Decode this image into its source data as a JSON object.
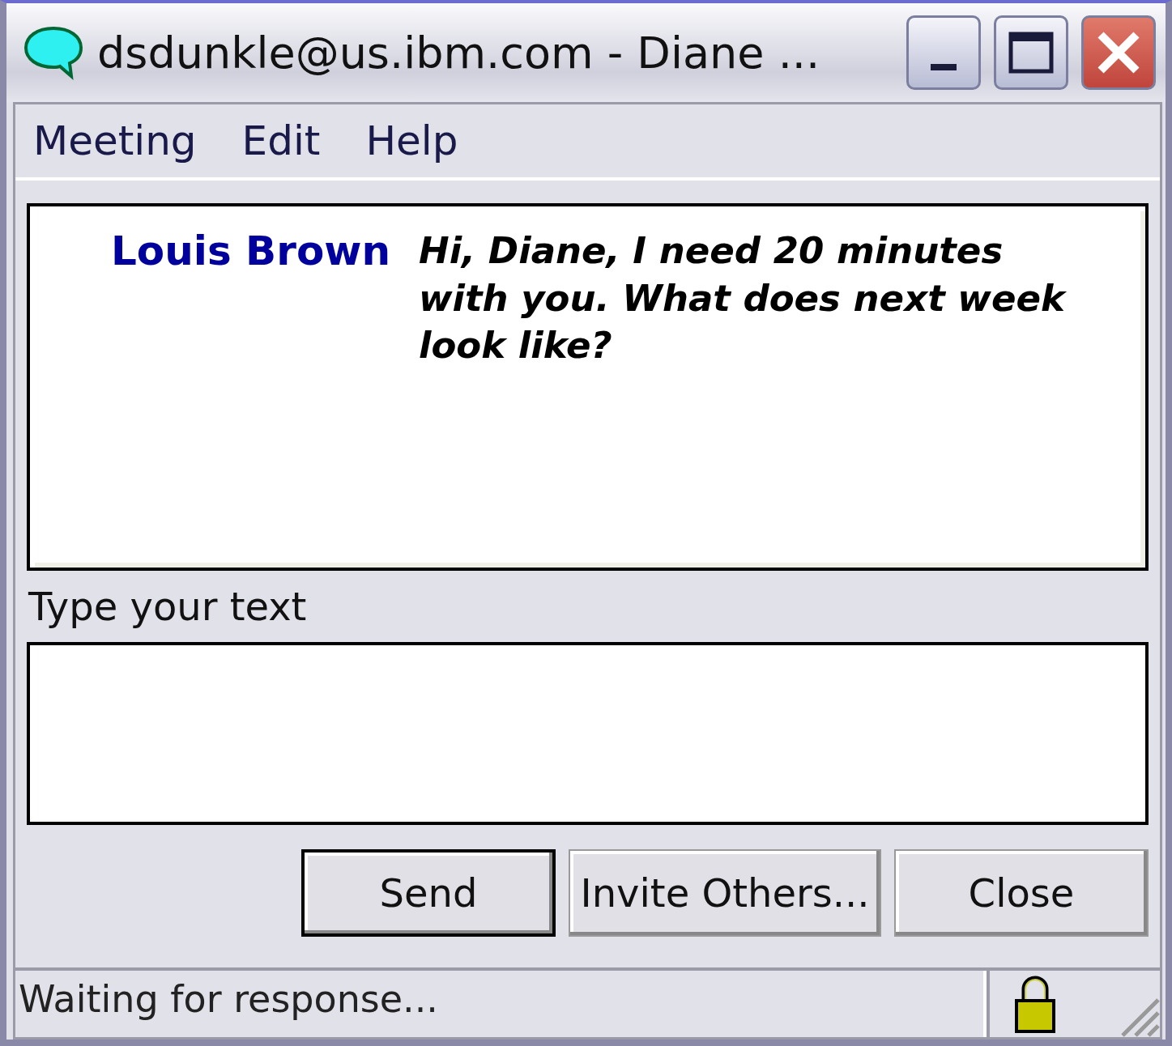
{
  "window": {
    "title": "dsdunkle@us.ibm.com - Diane ..."
  },
  "menu": [
    "Meeting",
    "Edit",
    "Help"
  ],
  "transcript": [
    {
      "sender": "Louis Brown",
      "text": "Hi, Diane, I need 20 minutes with you.  What does next week look like?"
    }
  ],
  "input_label": "Type your text",
  "buttons": [
    {
      "label": "Send",
      "default": true
    },
    {
      "label": "Invite Others...",
      "default": false
    },
    {
      "label": "Close",
      "default": false
    }
  ],
  "status_bar": {
    "text": "Waiting for response..."
  }
}
